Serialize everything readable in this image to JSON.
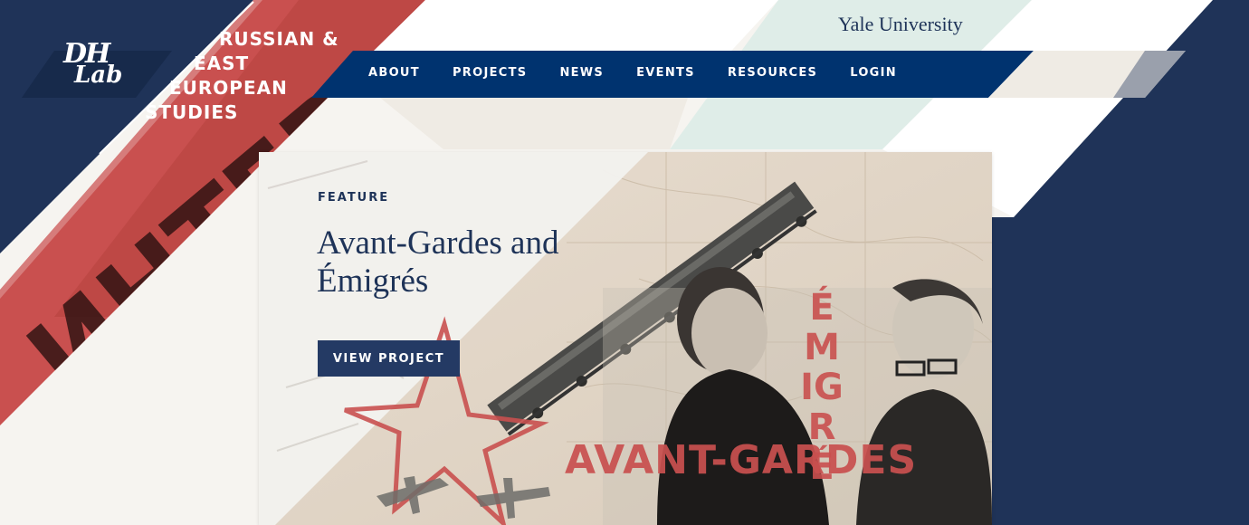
{
  "site": {
    "logo_line1": "DH",
    "logo_line2": "Lab",
    "title_lines": [
      "RUSSIAN &",
      "EAST",
      "EUROPEAN",
      "STUDIES"
    ]
  },
  "header": {
    "university": "Yale University"
  },
  "nav": {
    "items": [
      {
        "label": "ABOUT"
      },
      {
        "label": "PROJECTS"
      },
      {
        "label": "NEWS"
      },
      {
        "label": "EVENTS"
      },
      {
        "label": "RESOURCES"
      },
      {
        "label": "LOGIN"
      }
    ]
  },
  "feature": {
    "label": "FEATURE",
    "title": "Avant-Gardes and Émigrés",
    "button_label": "VIEW PROJECT",
    "poster_text_horizontal": "AVANT-GARDES",
    "poster_text_vertical": "ÉMIGRÉ"
  },
  "decor": {
    "background_red_text": "ИНТЕР"
  },
  "colors": {
    "navy": "#1f3358",
    "nav_blue": "#00336f",
    "red": "#c9504f",
    "mint": "#dfede8",
    "cream": "#f6f4f0"
  }
}
